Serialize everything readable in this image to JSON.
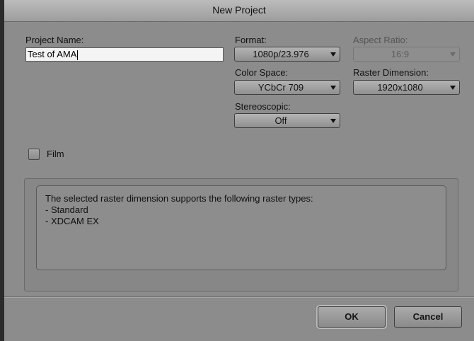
{
  "window": {
    "title": "New Project"
  },
  "project_name": {
    "label": "Project Name:",
    "value": "Test of AMA"
  },
  "format": {
    "label": "Format:",
    "value": "1080p/23.976"
  },
  "aspect_ratio": {
    "label": "Aspect Ratio:",
    "value": "16:9",
    "enabled": false
  },
  "color_space": {
    "label": "Color Space:",
    "value": "YCbCr 709"
  },
  "raster_dimension": {
    "label": "Raster Dimension:",
    "value": "1920x1080"
  },
  "stereoscopic": {
    "label": "Stereoscopic:",
    "value": "Off"
  },
  "film": {
    "label": "Film",
    "checked": false
  },
  "info": {
    "heading": "The selected raster dimension supports the following raster types:",
    "items": [
      " - Standard",
      " - XDCAM EX"
    ]
  },
  "buttons": {
    "ok": "OK",
    "cancel": "Cancel"
  },
  "colors": {
    "dialog_background": "#8c8c8c",
    "titlebar": "#bcbcbc",
    "input_background": "#f4f4f4"
  },
  "icons": {
    "dropdown": "chevron-down-icon",
    "checkbox": "checkbox-icon"
  }
}
